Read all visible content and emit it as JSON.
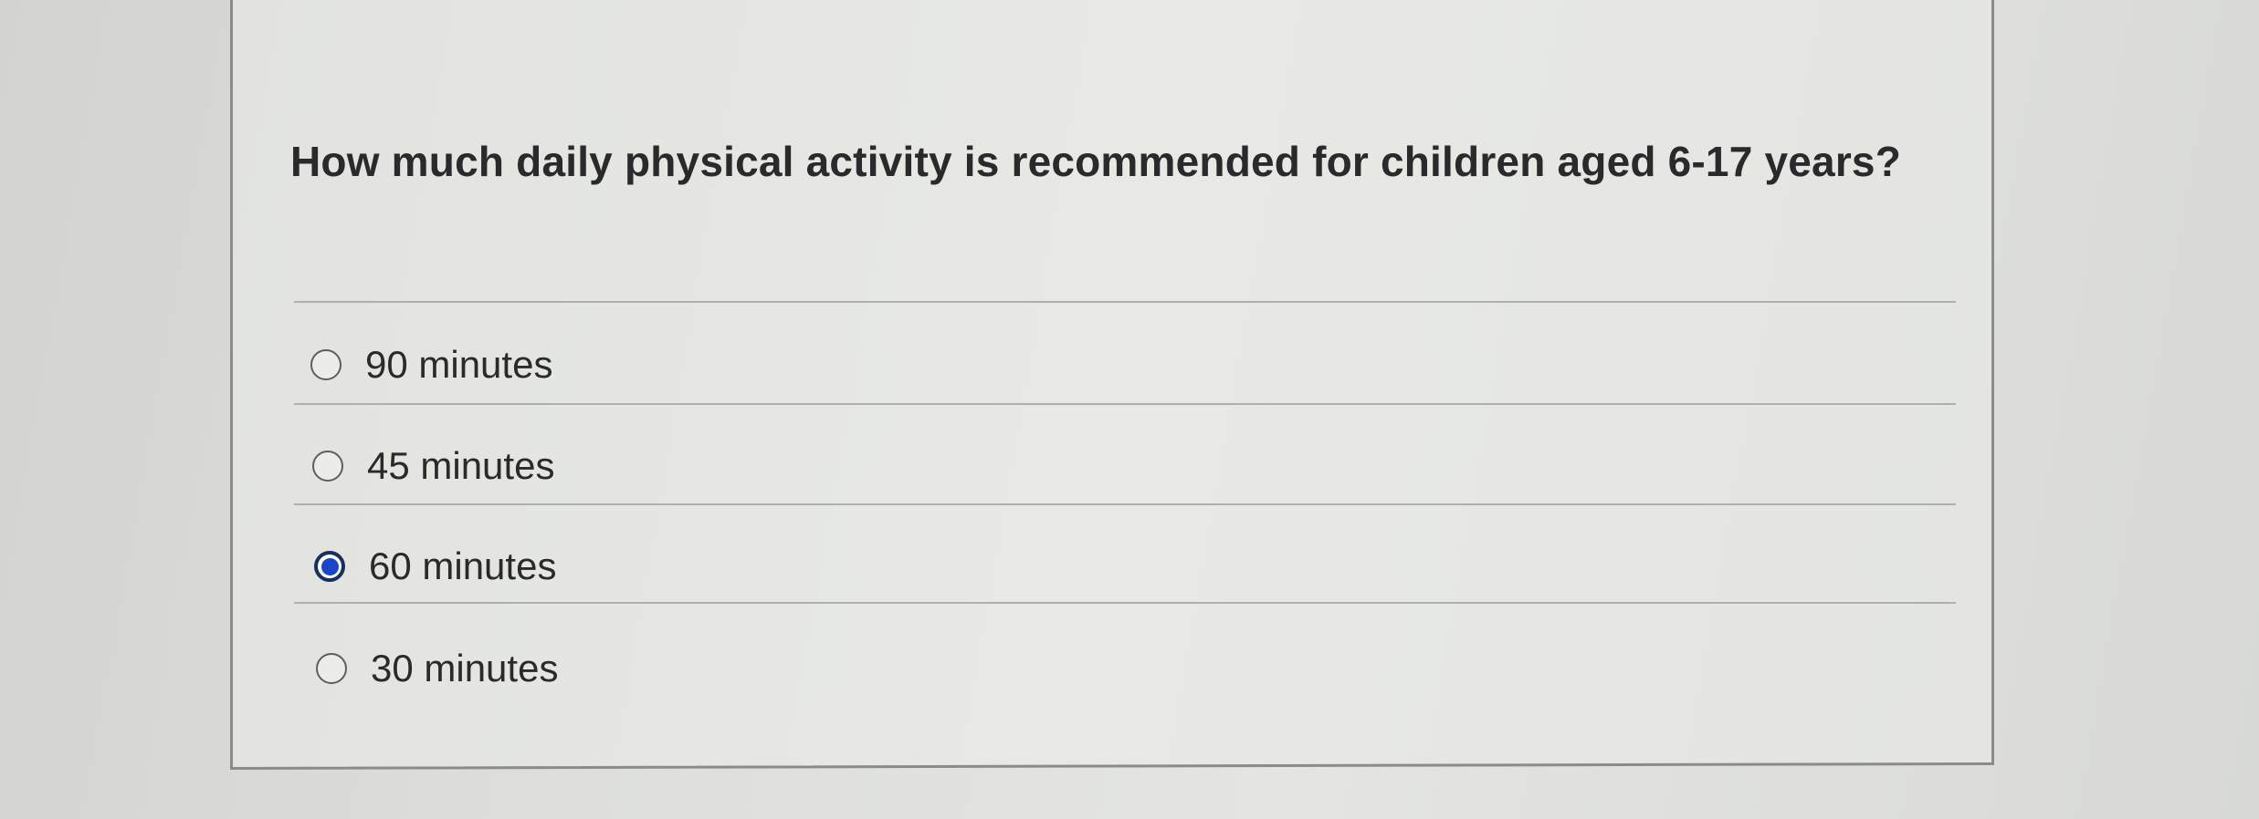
{
  "question": {
    "text": "How much daily physical activity is recommended for children aged 6-17 years?"
  },
  "options": [
    {
      "label": "90 minutes",
      "selected": false
    },
    {
      "label": "45 minutes",
      "selected": false
    },
    {
      "label": "60 minutes",
      "selected": true
    },
    {
      "label": "30 minutes",
      "selected": false
    }
  ],
  "colors": {
    "selected_radio": "#1b45c9",
    "text": "#2a2a2c"
  }
}
